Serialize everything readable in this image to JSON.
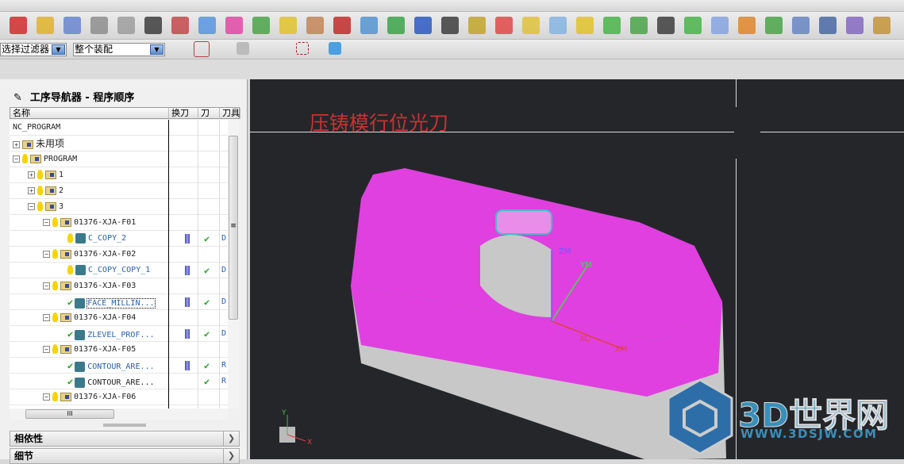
{
  "toolbar": {
    "selection_filter": "选择过滤器",
    "assembly_scope": "整个装配"
  },
  "navigator": {
    "title": "工序导航器 - 程序顺序",
    "columns": [
      "名称",
      "换刀",
      "刀",
      "刀具"
    ],
    "rows": [
      {
        "name": "NC_PROGRAM",
        "type": "root",
        "level": 0
      },
      {
        "name": "未用项",
        "type": "group",
        "level": 0,
        "expander": "+"
      },
      {
        "name": "PROGRAM",
        "type": "group",
        "level": 0,
        "expander": "-",
        "bulb": true
      },
      {
        "name": "1",
        "type": "group",
        "level": 1,
        "expander": "+",
        "bulb": true
      },
      {
        "name": "2",
        "type": "group",
        "level": 1,
        "expander": "+",
        "bulb": true
      },
      {
        "name": "3",
        "type": "group",
        "level": 1,
        "expander": "-",
        "bulb": true
      },
      {
        "name": "01376-XJA-F01",
        "type": "group",
        "level": 2,
        "expander": "-",
        "bulb": true
      },
      {
        "name": "C_COPY_2",
        "type": "op",
        "level": 3,
        "status": "bulb",
        "tool_change": true,
        "path": "✔",
        "tool": "D"
      },
      {
        "name": "01376-XJA-F02",
        "type": "group",
        "level": 2,
        "expander": "-",
        "bulb": true
      },
      {
        "name": "C_COPY_COPY_1",
        "type": "op",
        "level": 3,
        "status": "bulb",
        "tool_change": true,
        "path": "✔",
        "tool": "D"
      },
      {
        "name": "01376-XJA-F03",
        "type": "group",
        "level": 2,
        "expander": "-",
        "bulb": true
      },
      {
        "name": "FACE_MILLIN...",
        "type": "op",
        "level": 3,
        "status": "check",
        "tool_change": true,
        "path": "✔",
        "tool": "D",
        "selected": true
      },
      {
        "name": "01376-XJA-F04",
        "type": "group",
        "level": 2,
        "expander": "-",
        "bulb": true
      },
      {
        "name": "ZLEVEL_PROF...",
        "type": "op",
        "level": 3,
        "status": "check",
        "tool_change": true,
        "path": "✔",
        "tool": "D"
      },
      {
        "name": "01376-XJA-F05",
        "type": "group",
        "level": 2,
        "expander": "-",
        "bulb": true
      },
      {
        "name": "CONTOUR_ARE...",
        "type": "op",
        "level": 3,
        "status": "check",
        "tool_change": true,
        "path": "✔",
        "tool": "R"
      },
      {
        "name": "CONTOUR_ARE...",
        "type": "op",
        "level": 3,
        "status": "check",
        "tool_change": false,
        "path": "✔",
        "tool": "R",
        "dark": true
      },
      {
        "name": "01376-XJA-F06",
        "type": "group",
        "level": 2,
        "expander": "-",
        "bulb": true
      }
    ],
    "hscroll_grip": "III",
    "sections": [
      "相依性",
      "细节"
    ]
  },
  "viewport": {
    "title": "压铸模行位光刀",
    "title_color": "#c83232",
    "model_color": "#e040e0",
    "axis_labels": {
      "xc": "XC",
      "ym": "YM",
      "zm": "ZM",
      "xm": "XM",
      "triad_x": "X",
      "triad_y": "Y"
    }
  },
  "watermark": {
    "brand": "3D世界网",
    "url": "WWW.3DSJW.COM",
    "color": "#3a8fb8"
  }
}
